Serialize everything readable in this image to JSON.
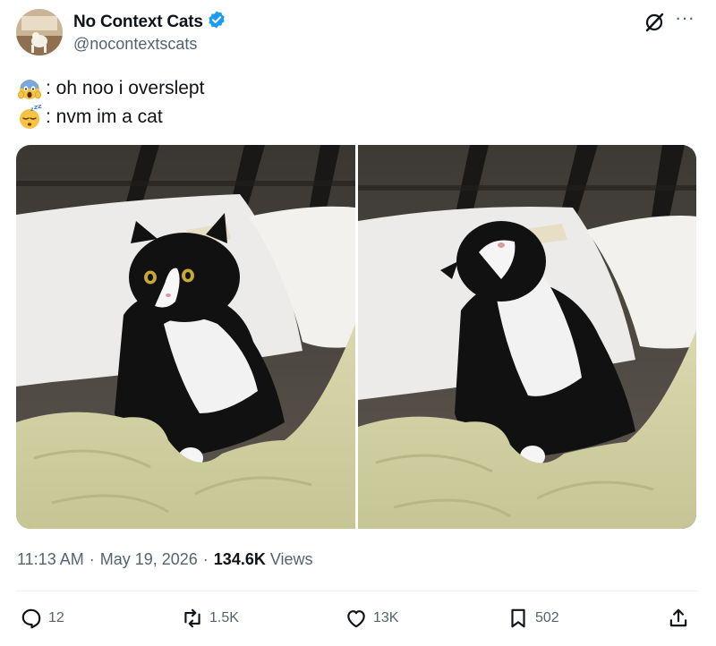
{
  "author": {
    "display_name": "No Context Cats",
    "handle": "@nocontextscats",
    "verified": true,
    "verified_color": "#1d9bf0"
  },
  "header_icons": {
    "grok": "grok-slash-icon",
    "more": "more-icon",
    "more_glyph": "···"
  },
  "tweet": {
    "lines": [
      {
        "emoji": "screaming-face-emoji",
        "text": ": oh noo i overslept"
      },
      {
        "emoji": "sleeping-face-emoji",
        "text": ": nvm im a cat"
      }
    ]
  },
  "media": {
    "photos": [
      {
        "subject": "black-and-white cat lying in bed, eyes open"
      },
      {
        "subject": "black-and-white cat lying in bed, head tilted back asleep"
      }
    ]
  },
  "meta": {
    "time": "11:13 AM",
    "separator": "·",
    "date": "May 19, 2026",
    "views_count": "134.6K",
    "views_label": "Views"
  },
  "actions": {
    "replies": "12",
    "reposts": "1.5K",
    "likes": "13K",
    "bookmarks": "502"
  },
  "colors": {
    "text": "#0f1419",
    "secondary": "#536471",
    "divider": "#eff3f4"
  }
}
